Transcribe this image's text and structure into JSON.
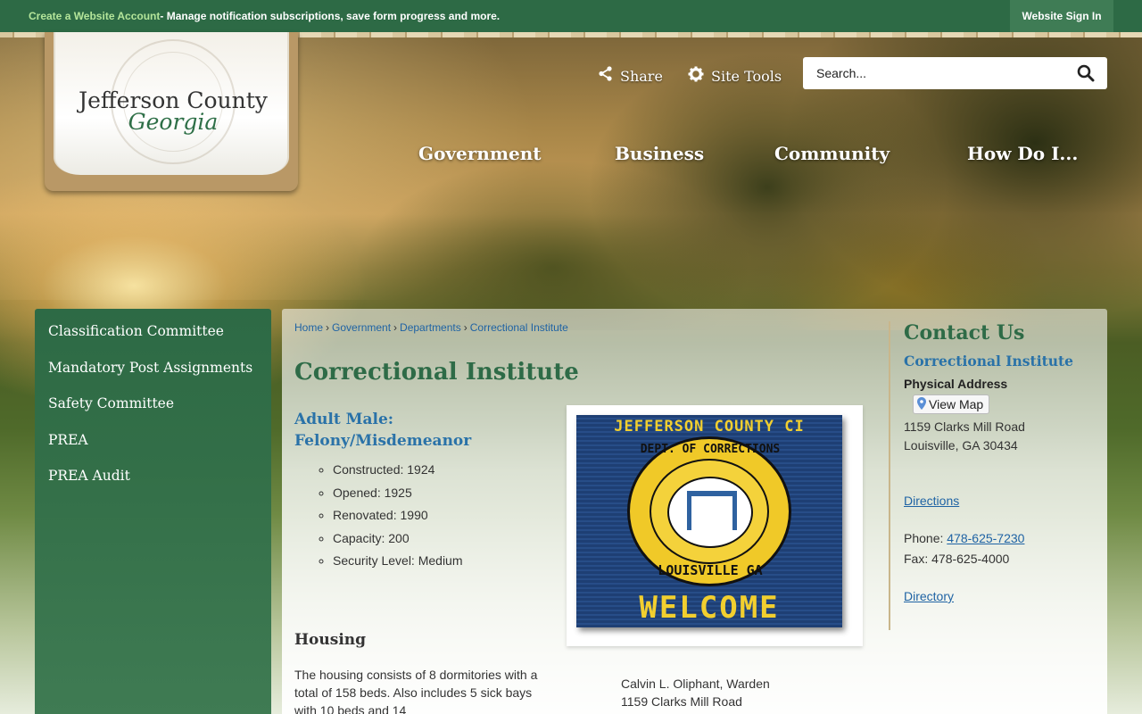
{
  "topbar": {
    "create_link": "Create a Website Account",
    "create_rest": " - Manage notification subscriptions, save form progress and more.",
    "signin": "Website Sign In"
  },
  "logo": {
    "county": "Jefferson County",
    "state": "Georgia"
  },
  "tools": {
    "share": "Share",
    "site_tools": "Site Tools"
  },
  "search": {
    "placeholder": "Search..."
  },
  "nav": [
    "Government",
    "Business",
    "Community",
    "How Do I..."
  ],
  "sidebar": {
    "items": [
      "Classification Committee",
      "Mandatory Post Assignments",
      "Safety Committee",
      "PREA",
      "PREA Audit"
    ]
  },
  "breadcrumb": [
    "Home",
    "Government",
    "Departments",
    "Correctional Institute"
  ],
  "page": {
    "title": "Correctional Institute",
    "subheading": "Adult Male: Felony/Misdemeanor",
    "facts": [
      "Constructed: 1924",
      "Opened: 1925",
      "Renovated: 1990",
      "Capacity: 200",
      "Security Level: Medium"
    ],
    "housing_title": "Housing",
    "housing_text": "The housing consists of 8 dormitories with a total of 158 beds. Also includes 5 sick bays with 10 beds and 14",
    "warden_name": "Calvin L. Oliphant, Warden",
    "warden_address": "1159 Clarks Mill Road"
  },
  "image": {
    "top_text": "JEFFERSON COUNTY CI",
    "ring_top": "DEPT. OF CORRECTIONS",
    "ring_bottom": "LOUISVILLE GA",
    "welcome": "WELCOME"
  },
  "contact": {
    "title": "Contact Us",
    "org": "Correctional Institute",
    "address_label": "Physical Address",
    "view_map": "View Map",
    "street": "1159 Clarks Mill Road",
    "city": "Louisville, GA 30434",
    "directions": "Directions",
    "phone_label": "Phone: ",
    "phone": "478-625-7230",
    "fax": "Fax: 478-625-4000",
    "directory": "Directory"
  },
  "colors": {
    "brand_green": "#2d6a45",
    "heading_green": "#2e6b47",
    "link_blue": "#1f63a4",
    "subheading_blue": "#2a72a8"
  }
}
